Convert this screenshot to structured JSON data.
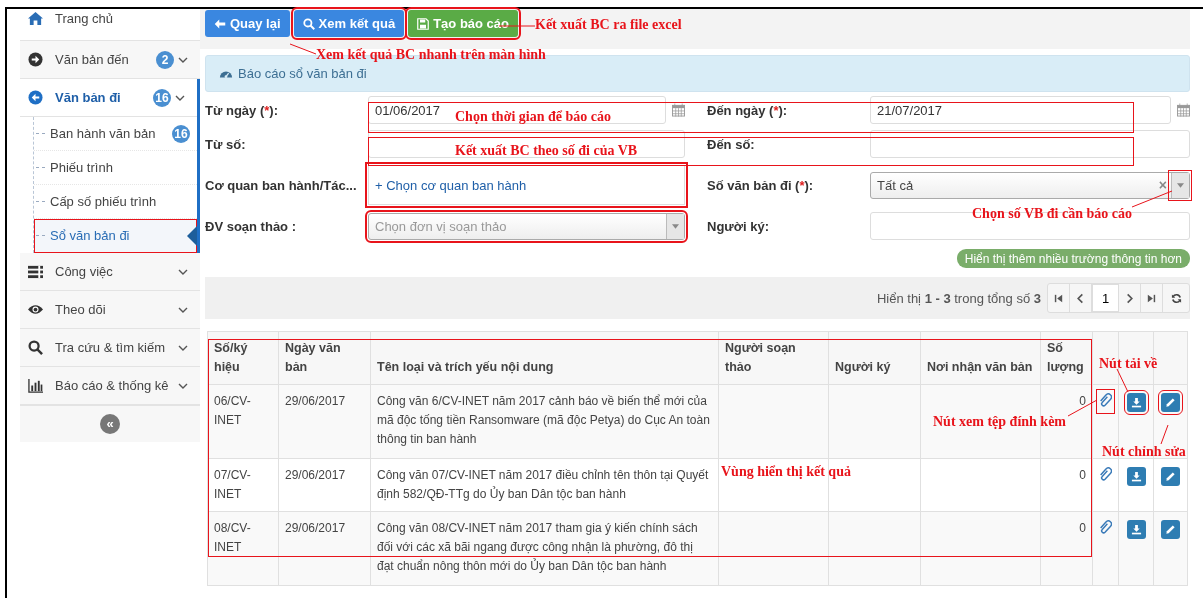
{
  "sidebar": {
    "items": [
      {
        "label": "Trang chủ"
      },
      {
        "label": "Văn bản đến",
        "badge": "2",
        "expanded": false
      },
      {
        "label": "Văn bản đi",
        "badge": "16",
        "expanded": true,
        "children": [
          {
            "label": "Ban hành văn bản",
            "badge": "16",
            "selected": false
          },
          {
            "label": "Phiếu trình",
            "selected": false
          },
          {
            "label": "Cấp số phiếu trình",
            "selected": false
          },
          {
            "label": "Sổ văn bản đi",
            "selected": true
          }
        ]
      },
      {
        "label": "Công việc",
        "expanded": false
      },
      {
        "label": "Theo dõi",
        "expanded": false
      },
      {
        "label": "Tra cứu & tìm kiếm",
        "expanded": false
      },
      {
        "label": "Báo cáo & thống kê",
        "expanded": false
      }
    ],
    "collapse_glyph": "«"
  },
  "toolbar": {
    "buttons": [
      {
        "label": "Quay lại",
        "kind": "back"
      },
      {
        "label": "Xem kết quả",
        "kind": "search"
      },
      {
        "label": "Tạo báo cáo",
        "kind": "report"
      }
    ]
  },
  "panel": {
    "title": "Báo cáo sổ văn bản đi"
  },
  "form": {
    "fields": [
      {
        "label": "Từ ngày (",
        "required_mark": "*",
        "label_tail": "):",
        "kind": "date",
        "value": "01/06/2017"
      },
      {
        "label": "Đến ngày (",
        "required_mark": "*",
        "label_tail": "):",
        "kind": "date",
        "value": "21/07/2017"
      },
      {
        "label": "Từ số:",
        "kind": "text"
      },
      {
        "label": "Đến số:",
        "kind": "text"
      },
      {
        "label": "Cơ quan ban hành/Tác...",
        "kind": "picker",
        "link": "+ Chọn cơ quan ban hành"
      },
      {
        "label": "Số văn bản đi (",
        "required_mark": "*",
        "label_tail": "):",
        "kind": "select",
        "value": "Tất cả",
        "clear": "×"
      },
      {
        "label": "ĐV soạn thảo :",
        "kind": "select",
        "placeholder": "Chọn đơn vị soạn thảo"
      },
      {
        "label": "Người ký:",
        "kind": "text"
      }
    ],
    "more_button": "Hiển thị thêm nhiều trường thông tin hơn"
  },
  "pager": {
    "summary": "Hiển thị **1 - 3** trong tổng số **3**",
    "page": "1"
  },
  "table": {
    "columns": [
      "Số/ký hiệu",
      "Ngày văn bản",
      "Tên loại và trích yếu nội dung",
      "Người soạn thảo",
      "Người ký",
      "Nơi nhận văn bản",
      "Số lượng"
    ],
    "rows": [
      {
        "number": "06/CV-INET",
        "date": "29/06/2017",
        "summary": "Công văn 6/CV-INET năm 2017 cảnh báo về biến thể mới của mã độc tống tiền Ransomware (mã độc Petya) do Cục An toàn thông tin ban hành",
        "quantity": "0"
      },
      {
        "number": "07/CV-INET",
        "date": "29/06/2017",
        "summary": "Công văn 07/CV-INET năm 2017 điều chỉnh tên thôn tại Quyết định 582/QĐ-TTg do Ủy ban Dân tộc ban hành",
        "quantity": "0"
      },
      {
        "number": "08/CV-INET",
        "date": "29/06/2017",
        "summary": "Công văn 08/CV-INET năm 2017 tham gia ý kiến chính sách đối với các xã bãi ngang được công nhận là phường, đô thị đạt chuẩn nông thôn mới do Ủy ban Dân tộc ban hành",
        "quantity": "0"
      }
    ]
  },
  "annotations": [
    {
      "text": "Kết xuất BC ra file excel"
    },
    {
      "text": "Xem kết quả BC nhanh trên màn hình"
    },
    {
      "text": "Chọn thời gian để báo cáo"
    },
    {
      "text": "Kết xuất BC theo số đi của VB"
    },
    {
      "text": "Chọn số VB đi cần báo cáo"
    },
    {
      "text": "Nút tải về"
    },
    {
      "text": "Nút xem tệp đính kèm"
    },
    {
      "text": "Nút chỉnh sửa"
    },
    {
      "text": "Vùng hiển thị kết quả"
    }
  ]
}
